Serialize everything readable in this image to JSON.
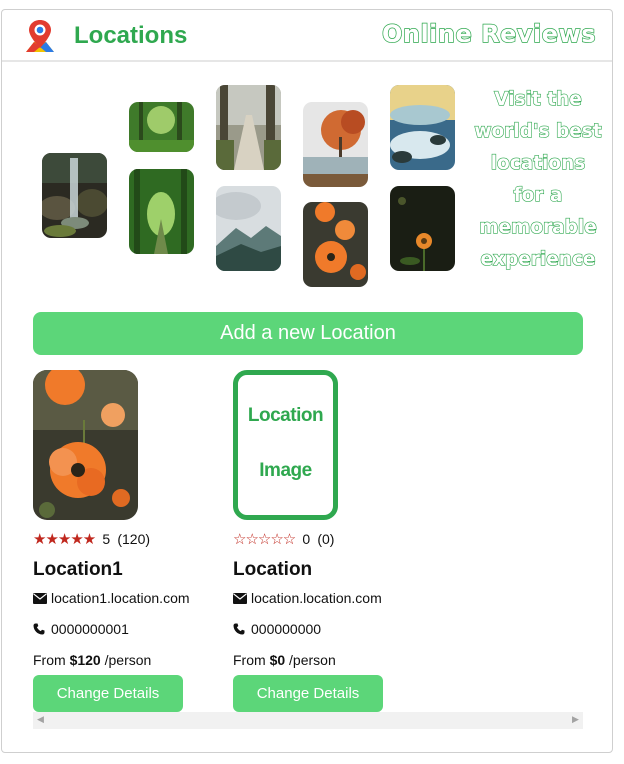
{
  "header": {
    "title": "Locations",
    "brand": "Online Reviews",
    "logo_icon": "map-pin-icon"
  },
  "hero": {
    "tagline_lines": [
      "Visit the",
      "world's best",
      "locations",
      "for a",
      "memorable",
      "experience"
    ],
    "tiles": [
      "waterfall",
      "green-forest",
      "forest-path",
      "autumn-lake",
      "ocean-rocks",
      "tree-tunnel",
      "cloudy-mountains",
      "orange-poppies",
      "dark-flower"
    ]
  },
  "actions": {
    "add_location": "Add a new Location"
  },
  "locations": [
    {
      "image": "orange-poppies",
      "stars": "★★★★★",
      "rating": "5",
      "reviews": "(120)",
      "name": "Location1",
      "email": "location1.location.com",
      "phone": "0000000001",
      "price_prefix": "From",
      "price": "$120",
      "price_suffix": "/person",
      "button": "Change Details"
    },
    {
      "image_placeholder": [
        "Location",
        "Image"
      ],
      "stars": "☆☆☆☆☆",
      "rating": "0",
      "reviews": "(0)",
      "name": "Location",
      "email": "location.location.com",
      "phone": "000000000",
      "price_prefix": "From",
      "price": "$0",
      "price_suffix": "/person",
      "button": "Change Details"
    }
  ],
  "colors": {
    "accent": "#2fa84f",
    "button": "#5cd679",
    "star": "#c0281e"
  }
}
